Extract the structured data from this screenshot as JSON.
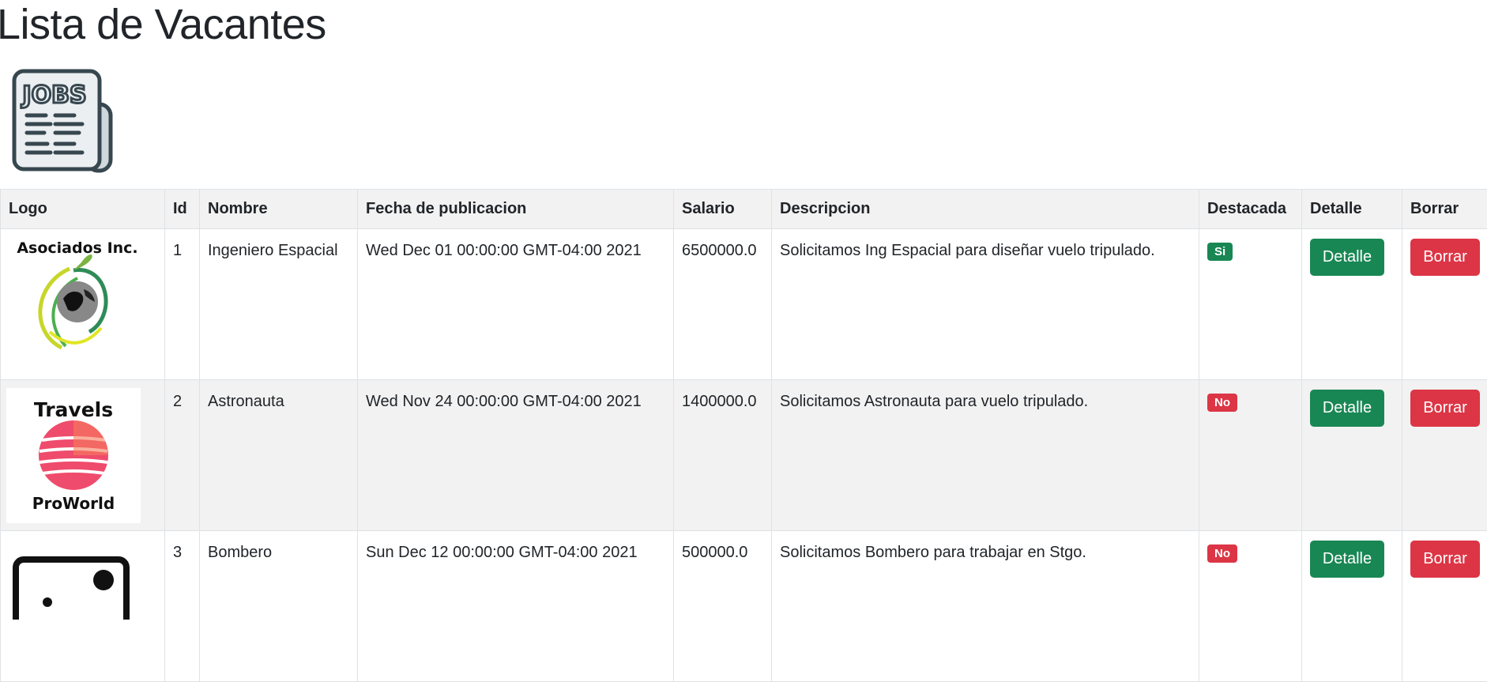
{
  "page": {
    "title": "Lista de Vacantes"
  },
  "header_logo": {
    "text": "JOBS"
  },
  "table": {
    "columns": [
      "Logo",
      "Id",
      "Nombre",
      "Fecha de publicacion",
      "Salario",
      "Descripcion",
      "Destacada",
      "Detalle",
      "Borrar"
    ],
    "rows": [
      {
        "logo_text": "Asociados Inc.",
        "id": "1",
        "nombre": "Ingeniero Espacial",
        "fecha": "Wed Dec 01 00:00:00 GMT-04:00 2021",
        "salario": "6500000.0",
        "descripcion": "Solicitamos Ing Espacial para diseñar vuelo tripulado.",
        "destacada": "Si",
        "detalle_label": "Detalle",
        "borrar_label": "Borrar"
      },
      {
        "logo_text_top": "Travels",
        "logo_text_bottom": "ProWorld",
        "id": "2",
        "nombre": "Astronauta",
        "fecha": "Wed Nov 24 00:00:00 GMT-04:00 2021",
        "salario": "1400000.0",
        "descripcion": "Solicitamos Astronauta para vuelo tripulado.",
        "destacada": "No",
        "detalle_label": "Detalle",
        "borrar_label": "Borrar"
      },
      {
        "id": "3",
        "nombre": "Bombero",
        "fecha": "Sun Dec 12 00:00:00 GMT-04:00 2021",
        "salario": "500000.0",
        "descripcion": "Solicitamos Bombero para trabajar en Stgo.",
        "destacada": "No",
        "detalle_label": "Detalle",
        "borrar_label": "Borrar"
      }
    ]
  },
  "colors": {
    "success": "#198754",
    "danger": "#dc3545",
    "header_bg": "#f2f2f2",
    "text": "#212529"
  }
}
